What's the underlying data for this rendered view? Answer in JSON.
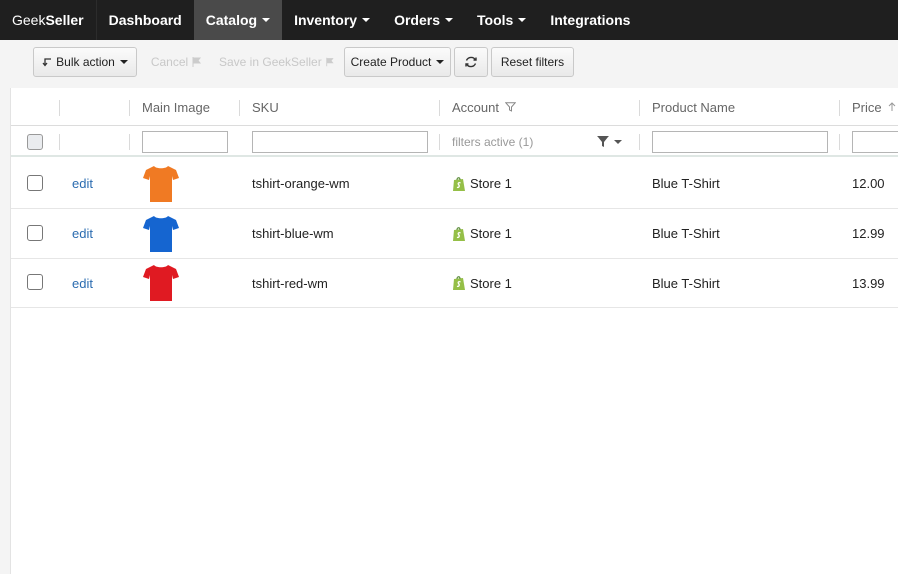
{
  "navbar": {
    "brand_left": "Geek",
    "brand_right": "Seller",
    "items": [
      {
        "label": "Dashboard"
      },
      {
        "label": "Catalog"
      },
      {
        "label": "Inventory"
      },
      {
        "label": "Orders"
      },
      {
        "label": "Tools"
      },
      {
        "label": "Integrations"
      }
    ]
  },
  "toolbar": {
    "bulk_action": "Bulk action",
    "cancel": "Cancel",
    "save": "Save in GeekSeller",
    "create_product": "Create Product",
    "reset_filters": "Reset filters"
  },
  "grid": {
    "columns": [
      "Main Image",
      "SKU",
      "Account",
      "Product Name",
      "Price"
    ],
    "account_filter_text": "filters active (1)",
    "edit_label": "edit",
    "rows": [
      {
        "sku": "tshirt-orange-wm",
        "account": "Store 1",
        "name": "Blue T-Shirt",
        "price": "12.00",
        "shirt_color": "#f07a23"
      },
      {
        "sku": "tshirt-blue-wm",
        "account": "Store 1",
        "name": "Blue T-Shirt",
        "price": "12.99",
        "shirt_color": "#1565d0"
      },
      {
        "sku": "tshirt-red-wm",
        "account": "Store 1",
        "name": "Blue T-Shirt",
        "price": "13.99",
        "shirt_color": "#e01a22"
      }
    ]
  },
  "icons": {
    "sort": "arrow-up-icon",
    "account_filter": "funnel-icon",
    "refresh": "refresh-icon",
    "store": "shopify-bag-icon"
  }
}
